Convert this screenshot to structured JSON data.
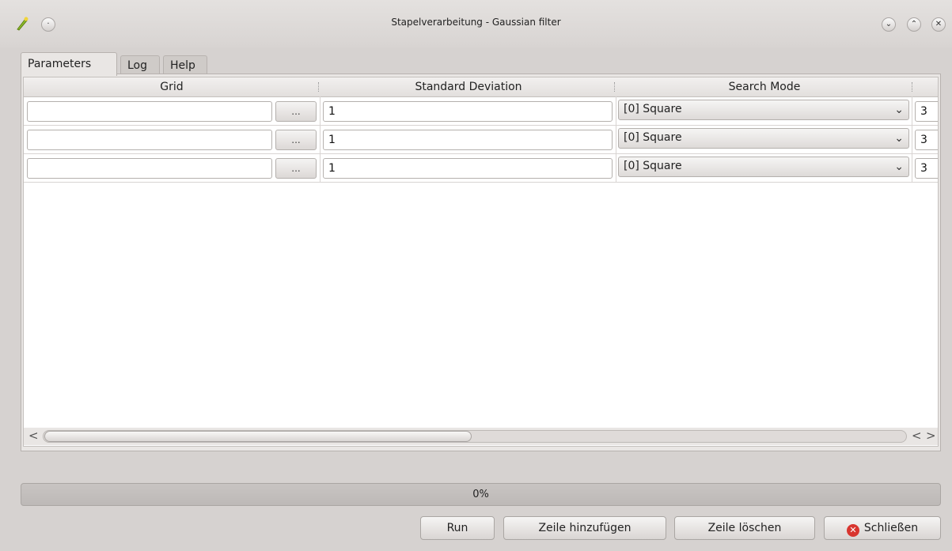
{
  "window": {
    "title": "Stapelverarbeitung - Gaussian filter",
    "menu_glyph": "·",
    "minimize_glyph": "⌄",
    "maximize_glyph": "⌃",
    "close_glyph": "✕"
  },
  "tabs": [
    {
      "label": "Parameters",
      "active": true
    },
    {
      "label": "Log",
      "active": false
    },
    {
      "label": "Help",
      "active": false
    }
  ],
  "table": {
    "columns": [
      "Grid",
      "Standard Deviation",
      "Search Mode"
    ],
    "browse_label": "...",
    "rows": [
      {
        "grid": "",
        "std_dev": "1",
        "search_mode": "[0] Square",
        "extra": "3"
      },
      {
        "grid": "",
        "std_dev": "1",
        "search_mode": "[0] Square",
        "extra": "3"
      },
      {
        "grid": "",
        "std_dev": "1",
        "search_mode": "[0] Square",
        "extra": "3"
      }
    ],
    "dropdown_glyph": "⌄"
  },
  "scrollbar": {
    "left_arrow": "<",
    "right_arrow": ">"
  },
  "progress": {
    "text": "0%",
    "value": 0
  },
  "buttons": {
    "run": "Run",
    "add_row": "Zeile hinzufügen",
    "delete_row": "Zeile löschen",
    "close": "Schließen",
    "close_icon_glyph": "✕"
  },
  "colors": {
    "close_icon": "#d8352f",
    "background": "#d6d2d0"
  }
}
